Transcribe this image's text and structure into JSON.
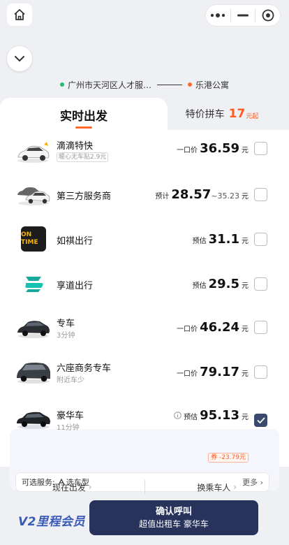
{
  "route": {
    "from": "广州市天河区人才服…",
    "to": "乐港公寓"
  },
  "tabs": {
    "realtime": "实时出发",
    "special": "特价拼车",
    "special_price": "17",
    "special_unit": "元起"
  },
  "rows": [
    {
      "name": "滴滴特快",
      "tag": "暖心无车贴2.9元",
      "price_prefix": "一口价",
      "price": "36.59",
      "unit": "元",
      "checked": false,
      "icon": "car-white-icon"
    },
    {
      "name": "第三方服务商",
      "price_prefix": "预计",
      "price": "28.57",
      "range": "~35.23",
      "unit": "元",
      "checked": false,
      "icon": "cars-group-icon"
    },
    {
      "name": "如祺出行",
      "price_prefix": "预估",
      "price": "31.1",
      "unit": "元",
      "checked": false,
      "icon": "ontime-logo",
      "logo_text": "ON TIME"
    },
    {
      "name": "享道出行",
      "price_prefix": "预估",
      "price": "29.5",
      "unit": "元",
      "checked": false,
      "icon": "xiangdao-logo"
    },
    {
      "name": "专车",
      "sub": "3分钟",
      "price_prefix": "一口价",
      "price": "46.24",
      "unit": "元",
      "checked": false,
      "icon": "car-black-icon"
    },
    {
      "name": "六座商务专车",
      "sub": "附近车少",
      "price_prefix": "一口价",
      "price": "79.17",
      "unit": "元",
      "checked": false,
      "icon": "van-icon"
    },
    {
      "name": "豪华车",
      "sub": "11分钟",
      "price_prefix": "预估",
      "price": "95.13",
      "unit": "元",
      "discount": "券 -23.79元",
      "checked": true,
      "icon": "luxury-car-icon"
    }
  ],
  "options": {
    "label": "可选服务:",
    "item": "选车型",
    "more": "更多"
  },
  "actions": {
    "depart": "现在出发",
    "rider": "换乘车人"
  },
  "bottom": {
    "vip": "V2里程会员",
    "confirm": "确认呼叫",
    "confirm_sub": "超值出租车 豪华车"
  },
  "colors": {
    "accent": "#ff6a2d",
    "confirm_bg": "#27335a",
    "vip": "#3a5ab8"
  }
}
